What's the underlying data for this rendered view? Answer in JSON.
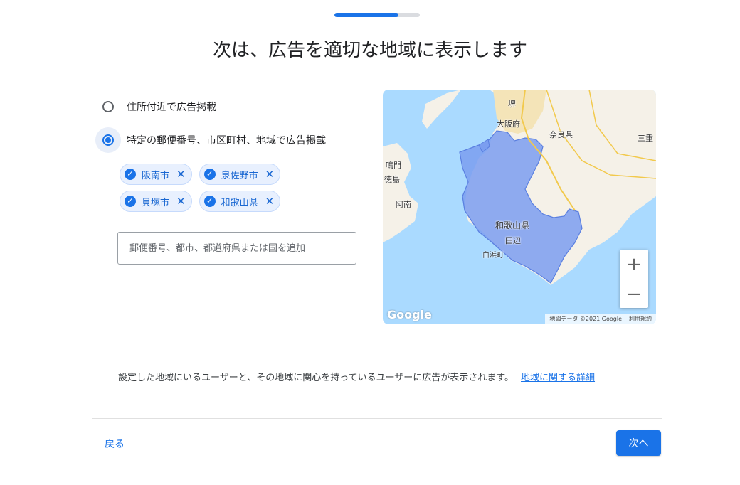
{
  "progress": {
    "fraction": 0.75
  },
  "title": "次は、広告を適切な地域に表示します",
  "options": [
    {
      "label": "住所付近で広告掲載",
      "selected": false
    },
    {
      "label": "特定の郵便番号、市区町村、地域で広告掲載",
      "selected": true
    }
  ],
  "chips": [
    {
      "label": "阪南市"
    },
    {
      "label": "泉佐野市"
    },
    {
      "label": "貝塚市"
    },
    {
      "label": "和歌山県"
    }
  ],
  "location_input": {
    "value": "",
    "placeholder": "郵便番号、都市、都道府県または国を追加"
  },
  "map": {
    "labels": {
      "sakai": "堺",
      "osaka": "大阪府",
      "nara": "奈良県",
      "mie": "三重",
      "naruto": "鳴門",
      "tokushima": "徳島",
      "anan": "阿南",
      "wakayama": "和歌山県",
      "tanabe": "田辺",
      "shirahama": "白浜町"
    },
    "logo": "Google",
    "attribution": "地図データ ©2021 Google",
    "terms": "利用規約",
    "zoom_in": "+",
    "zoom_out": "−",
    "colors": {
      "water": "#aadaff",
      "land": "#f5f1e8",
      "region": "#7b9ef0"
    }
  },
  "info": {
    "text": "設定した地域にいるユーザーと、その地域に関心を持っているユーザーに広告が表示されます。",
    "link": "地域に関する詳細"
  },
  "footer": {
    "back": "戻る",
    "next": "次へ"
  },
  "icons": {
    "check": "check-icon",
    "close": "close-icon"
  }
}
